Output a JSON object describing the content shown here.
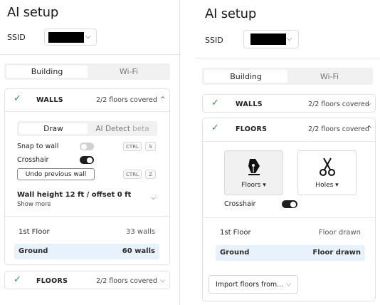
{
  "left": {
    "title": "AI setup",
    "ssid_label": "SSID",
    "tabs": [
      "Building",
      "Wi-Fi"
    ],
    "walls": {
      "name": "WALLS",
      "status": "2/2 floors covered",
      "subtabs": [
        "Draw",
        "AI Detect",
        "beta"
      ],
      "snap_label": "Snap to wall",
      "snap_keys": [
        "CTRL",
        "S"
      ],
      "crosshair_label": "Crosshair",
      "undo_label": "Undo previous wall",
      "undo_keys": [
        "CTRL",
        "Z"
      ],
      "wall_height": "Wall height 12 ft / offset 0 ft",
      "show_more": "Show more",
      "floors": [
        {
          "name": "1st Floor",
          "value": "33 walls"
        },
        {
          "name": "Ground",
          "value": "60 walls"
        }
      ]
    },
    "floors": {
      "name": "FLOORS",
      "status": "2/2 floors covered"
    }
  },
  "right": {
    "title": "AI setup",
    "ssid_label": "SSID",
    "tabs": [
      "Building",
      "Wi-Fi"
    ],
    "walls": {
      "name": "WALLS",
      "status": "2/2 floors covered"
    },
    "floors": {
      "name": "FLOORS",
      "status": "2/2 floors covered",
      "tools": [
        {
          "label": "Floors ▾",
          "icon": "pen-nib-icon"
        },
        {
          "label": "Holes ▾",
          "icon": "scissors-icon"
        }
      ],
      "crosshair_label": "Crosshair",
      "list": [
        {
          "name": "1st Floor",
          "value": "Floor drawn"
        },
        {
          "name": "Ground",
          "value": "Floor drawn"
        }
      ],
      "import_label": "Import floors from..."
    }
  },
  "colors": {
    "check": "#2e9a3c",
    "selected_row": "#e8f2fc",
    "toggle_on": "#1f1f1f",
    "toggle_off": "#d0d0d0"
  }
}
